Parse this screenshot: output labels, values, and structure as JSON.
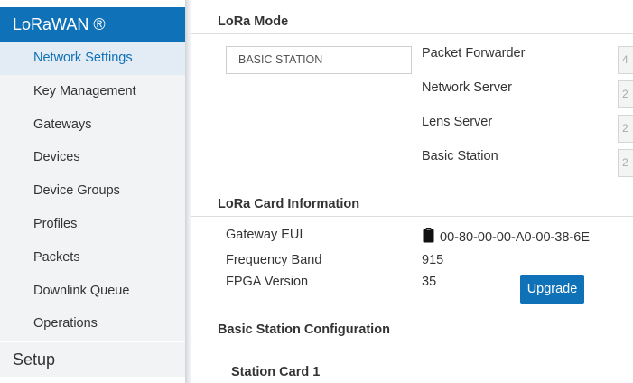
{
  "sidebar": {
    "active_section": "LoRaWAN ®",
    "items": [
      {
        "label": "Network Settings",
        "selected": true
      },
      {
        "label": "Key Management",
        "selected": false
      },
      {
        "label": "Gateways",
        "selected": false
      },
      {
        "label": "Devices",
        "selected": false
      },
      {
        "label": "Device Groups",
        "selected": false
      },
      {
        "label": "Profiles",
        "selected": false
      },
      {
        "label": "Packets",
        "selected": false
      },
      {
        "label": "Downlink Queue",
        "selected": false
      },
      {
        "label": "Operations",
        "selected": false
      }
    ],
    "next_section": "Setup"
  },
  "lora_mode": {
    "title": "LoRa Mode",
    "selected_mode": "BASIC STATION",
    "modes": [
      {
        "label": "Packet Forwarder",
        "port_value": "4"
      },
      {
        "label": "Network Server",
        "port_value": "2"
      },
      {
        "label": "Lens Server",
        "port_value": "2"
      },
      {
        "label": "Basic Station",
        "port_value": "2"
      }
    ]
  },
  "card_info": {
    "title": "LoRa Card Information",
    "gateway_eui_label": "Gateway EUI",
    "gateway_eui_value": "00-80-00-00-A0-00-38-6E",
    "frequency_band_label": "Frequency Band",
    "frequency_band_value": "915",
    "fpga_version_label": "FPGA Version",
    "fpga_version_value": "35",
    "upgrade_label": "Upgrade",
    "clipboard_icon": "clipboard-icon"
  },
  "basic_station": {
    "title": "Basic Station Configuration",
    "card_title": "Station Card 1"
  },
  "colors": {
    "accent": "#0f72b8",
    "selected_bg": "#e3ebf4",
    "sidebar_bg": "#f2f3f5"
  }
}
